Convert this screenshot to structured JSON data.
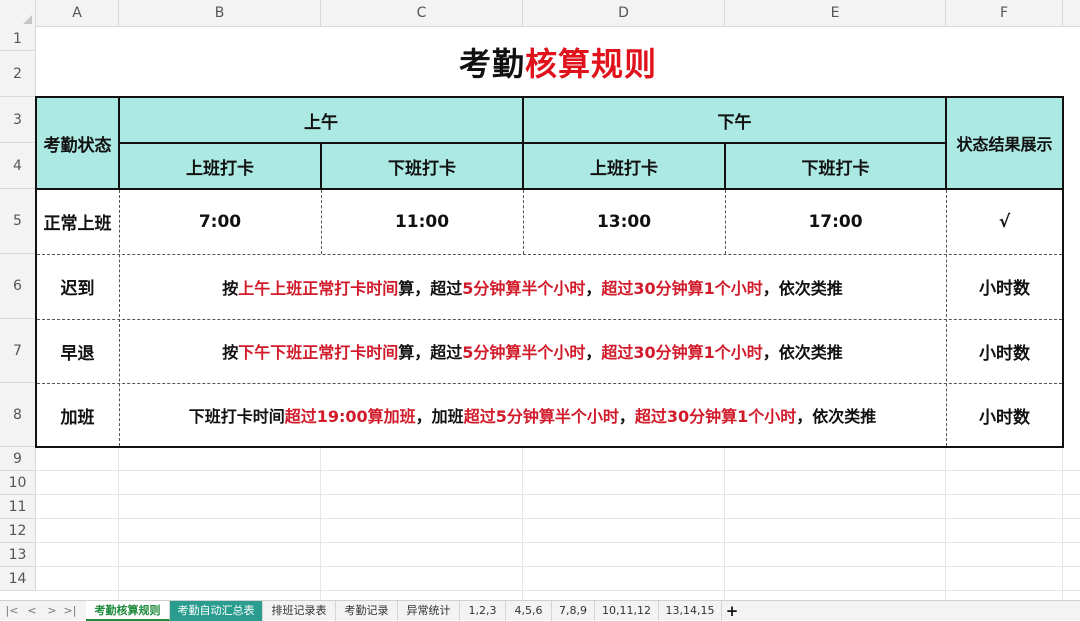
{
  "columns": [
    "A",
    "B",
    "C",
    "D",
    "E",
    "F"
  ],
  "rows": [
    "1",
    "2",
    "3",
    "4",
    "5",
    "6",
    "7",
    "8",
    "9",
    "10",
    "11",
    "12",
    "13",
    "14"
  ],
  "title": {
    "part1": "考勤",
    "part2": "核算规则"
  },
  "header": {
    "status": "考勤状态",
    "morning": "上午",
    "afternoon": "下午",
    "result": "状态结果展示",
    "am_in": "上班打卡",
    "am_out": "下班打卡",
    "pm_in": "上班打卡",
    "pm_out": "下班打卡"
  },
  "normal": {
    "label": "正常上班",
    "am_in": "7:00",
    "am_out": "11:00",
    "pm_in": "13:00",
    "pm_out": "17:00",
    "result": "√"
  },
  "late": {
    "label": "迟到",
    "rule": [
      "按",
      "上午上班正常打卡时间",
      "算，超过",
      "5分钟算半个小时",
      "，",
      "超过30分钟算1个小时",
      "，依次类推"
    ],
    "result": "小时数"
  },
  "early": {
    "label": "早退",
    "rule": [
      "按",
      "下午下班正常打卡时间",
      "算，超过",
      "5分钟算半个小时",
      "，",
      "超过30分钟算1个小时",
      "，依次类推"
    ],
    "result": "小时数"
  },
  "overtime": {
    "label": "加班",
    "rule": [
      "下班打卡时间",
      "超过19:00算加班",
      "，加班",
      "超过5分钟算半个小时",
      "，",
      "超过30分钟算1个小时",
      "，依次类推"
    ],
    "result": "小时数"
  },
  "tabs": [
    "考勤核算规则",
    "考勤自动汇总表",
    "排班记录表",
    "考勤记录",
    "异常统计",
    "1,2,3",
    "4,5,6",
    "7,8,9",
    "10,11,12",
    "13,14,15",
    "+"
  ],
  "nav": [
    "|<",
    "<",
    ">",
    ">|"
  ],
  "colors": {
    "header_bg": "#ade9e3",
    "red": "#e0121b",
    "active_tab": "#1e8a3c",
    "teal_tab": "#2a9d8f"
  }
}
